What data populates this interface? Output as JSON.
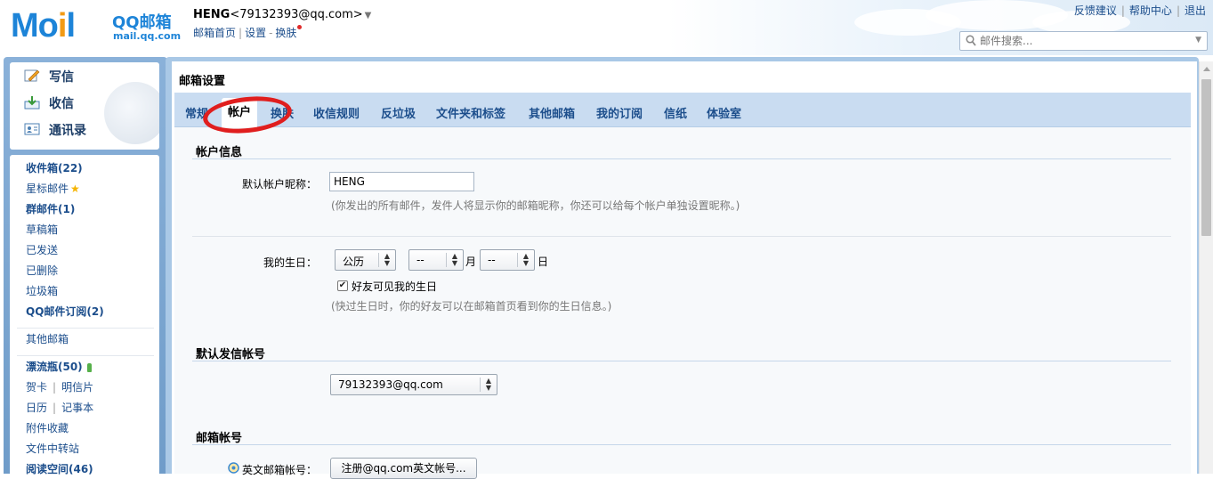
{
  "header": {
    "logo": {
      "mail_text": "Mo",
      "bell_char": "i",
      "l_char": "l",
      "brand": "QQ邮箱",
      "domain": "mail.qq.com"
    },
    "user": {
      "nickname": "HENG",
      "email": "<79132393@qq.com>",
      "caret": "▼"
    },
    "user_links": {
      "home": "邮箱首页",
      "settings": "设置",
      "skin": "换肤",
      "sep1": "|",
      "sep2": "-"
    },
    "top_links": {
      "feedback": "反馈建议",
      "help": "帮助中心",
      "logout": "退出",
      "sep": "|"
    },
    "search": {
      "placeholder": "邮件搜索..."
    }
  },
  "left": {
    "actions": {
      "compose": "写信",
      "inbox": "收信",
      "contacts": "通讯录"
    },
    "folders": {
      "inbox": "收件箱(22)",
      "starred": "星标邮件",
      "group": "群邮件(1)",
      "drafts": "草稿箱",
      "sent": "已发送",
      "deleted": "已删除",
      "spam": "垃圾箱",
      "subscriptions": "QQ邮件订阅(2)",
      "other": "其他邮箱",
      "bottle": "漂流瓶(50)",
      "cards": "贺卡",
      "postcards": "明信片",
      "calendar": "日历",
      "notes": "记事本",
      "attachments": "附件收藏",
      "transfer": "文件中转站",
      "reading": "阅读空间(46)",
      "sep": "|"
    }
  },
  "main": {
    "title": "邮箱设置",
    "tabs": {
      "general": "常规",
      "account": "帐户",
      "skin": "换肤",
      "rules": "收信规则",
      "antispam": "反垃圾",
      "folders": "文件夹和标签",
      "other": "其他邮箱",
      "subscriptions": "我的订阅",
      "stationery": "信纸",
      "lab": "体验室"
    },
    "account_info": {
      "title": "帐户信息",
      "nickname_label": "默认帐户昵称：",
      "nickname_value": "HENG",
      "nickname_hint": "(你发出的所有邮件，发件人将显示你的邮箱昵称，你还可以给每个帐户单独设置昵称。)",
      "birthday_label": "我的生日：",
      "calendar_type": "公历",
      "month_value": "--",
      "month_unit": "月",
      "day_value": "--",
      "day_unit": "日",
      "friends_visible_label": "好友可见我的生日",
      "friends_visible_checked": true,
      "birthday_hint": "(快过生日时，你的好友可以在邮箱首页看到你的生日信息。)"
    },
    "default_sender": {
      "title": "默认发信帐号",
      "value": "79132393@qq.com"
    },
    "mail_accounts": {
      "title": "邮箱帐号",
      "english_label": "英文邮箱帐号：",
      "english_button": "注册@qq.com英文帐号..."
    }
  },
  "colors": {
    "link": "#1c4e8c",
    "tab_bar": "#c9dcf1",
    "frame": "#a9c8e6",
    "annotation": "#e01e1e",
    "logo_blue": "#1d84d8",
    "logo_orange": "#f29a14"
  }
}
